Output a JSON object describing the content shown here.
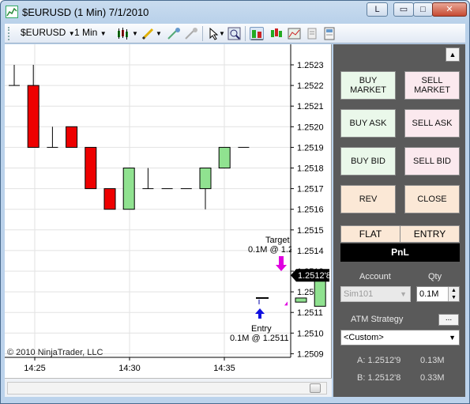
{
  "window": {
    "title": "$EURUSD (1 Min)  7/1/2010",
    "link_button_label": "L",
    "minimize_glyph": "▭",
    "maximize_glyph": "□",
    "close_glyph": "✕"
  },
  "toolbar": {
    "instrument": "$EURUSD",
    "interval": "1 Min",
    "icons": [
      "bar-type-icon",
      "drawing-pencil-icon",
      "drawing-tools-icon",
      "dropdown-arrow-icon",
      "pointer-icon",
      "zoom-icon",
      "chart-trader-icon",
      "data-series-icon",
      "indicators-icon",
      "properties-icon",
      "layout-icon"
    ]
  },
  "chart_data": {
    "type": "candlestick",
    "title": "",
    "x_ticks": [
      "14:25",
      "14:30",
      "14:35"
    ],
    "y_ticks": [
      "1.2523",
      "1.2522",
      "1.2521",
      "1.2520",
      "1.2519",
      "1.2518",
      "1.2517",
      "1.2516",
      "1.2515",
      "1.2514",
      "1.2513",
      "1.2512",
      "1.2511",
      "1.2510",
      "1.2509"
    ],
    "ylim": [
      1.25087,
      1.25242
    ],
    "grid": true,
    "colors": {
      "up": "#90e290",
      "down": "#ee0000",
      "outline": "#000000"
    },
    "bars": [
      {
        "o": 1.2522,
        "h": 1.2523,
        "l": 1.2522,
        "c": 1.2522
      },
      {
        "o": 1.2522,
        "h": 1.2523,
        "l": 1.2519,
        "c": 1.2519
      },
      {
        "o": 1.2519,
        "h": 1.252,
        "l": 1.2519,
        "c": 1.2519
      },
      {
        "o": 1.252,
        "h": 1.252,
        "l": 1.2519,
        "c": 1.2519
      },
      {
        "o": 1.2519,
        "h": 1.2519,
        "l": 1.2517,
        "c": 1.2517
      },
      {
        "o": 1.2517,
        "h": 1.2517,
        "l": 1.2516,
        "c": 1.2516
      },
      {
        "o": 1.2516,
        "h": 1.2518,
        "l": 1.2516,
        "c": 1.2518
      },
      {
        "o": 1.2517,
        "h": 1.2518,
        "l": 1.2517,
        "c": 1.2517
      },
      {
        "o": 1.2517,
        "h": 1.2517,
        "l": 1.2517,
        "c": 1.2517
      },
      {
        "o": 1.2517,
        "h": 1.2517,
        "l": 1.2517,
        "c": 1.2517
      },
      {
        "o": 1.2517,
        "h": 1.2518,
        "l": 1.2516,
        "c": 1.2518
      },
      {
        "o": 1.2518,
        "h": 1.2519,
        "l": 1.2518,
        "c": 1.2519
      },
      {
        "o": 1.2519,
        "h": 1.2519,
        "l": 1.2519,
        "c": 1.2519
      },
      null,
      null,
      {
        "o": 1.25115,
        "h": 1.25117,
        "l": 1.25115,
        "c": 1.25117
      },
      {
        "o": 1.25113,
        "h": 1.25126,
        "l": 1.25113,
        "c": 1.25126
      }
    ],
    "last_price_label": "1.2512'8",
    "last_price": 1.25128,
    "target_label": "Target",
    "target_detail": "0.1M @ 1.2",
    "entry_label": "Entry",
    "entry_detail": "0.1M @ 1.2511",
    "entry_price": 1.25117
  },
  "chart": {
    "copyright": "© 2010 NinjaTrader, LLC"
  },
  "trader": {
    "buy_market": "BUY\nMARKET",
    "sell_market": "SELL\nMARKET",
    "buy_ask": "BUY ASK",
    "sell_ask": "SELL ASK",
    "buy_bid": "BUY BID",
    "sell_bid": "SELL BID",
    "rev": "REV",
    "close": "CLOSE",
    "flat": "FLAT",
    "entry": "ENTRY",
    "pnl": "PnL",
    "account_label": "Account",
    "qty_label": "Qty",
    "account_value": "Sim101",
    "qty_value": "0.1M",
    "atm_label": "ATM Strategy",
    "atm_more": "...",
    "atm_value": "<Custom>",
    "ask_line": "A: 1.2512'9",
    "ask_size": "0.13M",
    "bid_line": "B: 1.2512'8",
    "bid_size": "0.33M",
    "collapse_glyph": "▲"
  }
}
